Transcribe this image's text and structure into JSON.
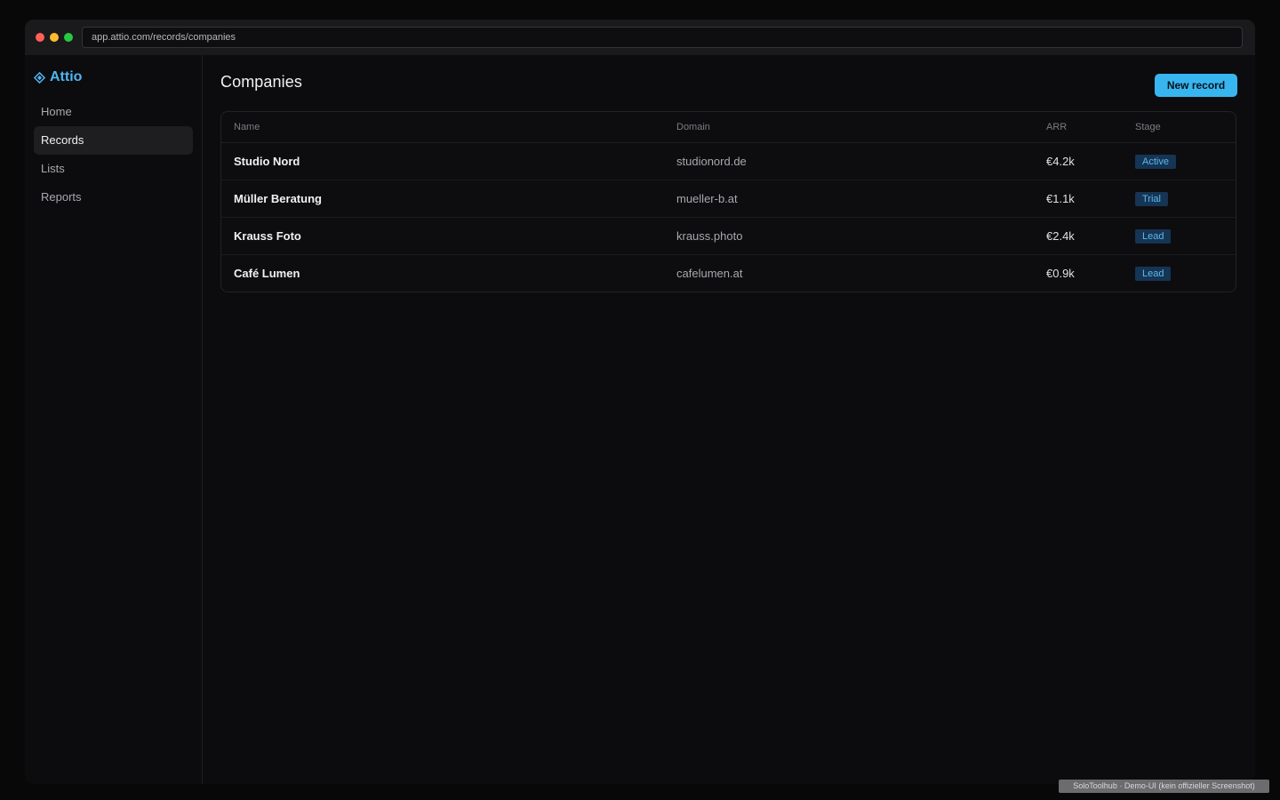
{
  "browser": {
    "url": "app.attio.com/records/companies"
  },
  "sidebar": {
    "brand": "Attio",
    "brand_icon": "diamond-icon",
    "items": [
      {
        "label": "Home",
        "active": false
      },
      {
        "label": "Records",
        "active": true
      },
      {
        "label": "Lists",
        "active": false
      },
      {
        "label": "Reports",
        "active": false
      }
    ]
  },
  "main": {
    "title": "Companies",
    "new_button": "New record",
    "table": {
      "columns": [
        "Name",
        "Domain",
        "ARR",
        "Stage"
      ],
      "rows": [
        {
          "name": "Studio Nord",
          "domain": "studionord.de",
          "arr": "€4.2k",
          "stage": "Active"
        },
        {
          "name": "Müller Beratung",
          "domain": "mueller-b.at",
          "arr": "€1.1k",
          "stage": "Trial"
        },
        {
          "name": "Krauss Foto",
          "domain": "krauss.photo",
          "arr": "€2.4k",
          "stage": "Lead"
        },
        {
          "name": "Café Lumen",
          "domain": "cafelumen.at",
          "arr": "€0.9k",
          "stage": "Lead"
        }
      ]
    }
  },
  "colors": {
    "accent": "#38b5ef",
    "brand": "#4fb5f2",
    "badge_bg": "#163453",
    "badge_text": "#5db8ef"
  },
  "watermark": "SoloToolhub · Demo-UI (kein offizieller Screenshot)"
}
